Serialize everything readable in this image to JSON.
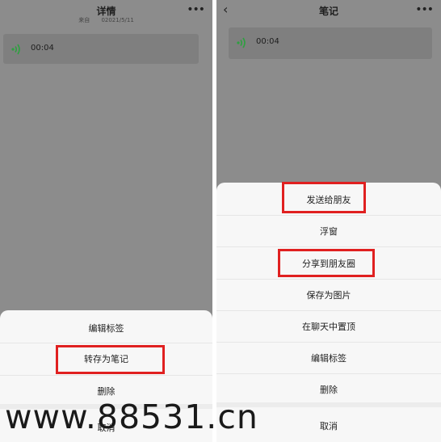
{
  "left": {
    "title": "详情",
    "subtitle_from": "来自",
    "subtitle_date": "02021/5/11",
    "voice_duration": "00:04",
    "sheet_items": [
      {
        "label": "编辑标签"
      },
      {
        "label": "转存为笔记"
      },
      {
        "label": "删除"
      }
    ],
    "cancel_label": "取消"
  },
  "right": {
    "title": "笔记",
    "voice_duration": "00:04",
    "sheet_items": [
      {
        "label": "发送给朋友"
      },
      {
        "label": "浮窗"
      },
      {
        "label": "分享到朋友圈"
      },
      {
        "label": "保存为图片"
      },
      {
        "label": "在聊天中置顶"
      },
      {
        "label": "编辑标签"
      },
      {
        "label": "删除"
      }
    ],
    "cancel_label": "取消"
  },
  "icons": {
    "more": "more-icon",
    "back": "back-icon",
    "voice": "voice-wave-icon"
  },
  "colors": {
    "highlight": "#e02020",
    "voice_green": "#2ea040",
    "overlay_gray": "#8c8c8c",
    "sheet_bg": "#f7f7f7"
  },
  "watermark": "www.88531.cn"
}
